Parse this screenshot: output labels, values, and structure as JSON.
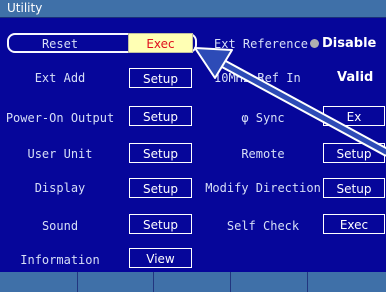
{
  "title": "Utility",
  "left_items": [
    {
      "label": "Reset",
      "button": "Exec"
    },
    {
      "label": "Ext Add",
      "button": "Setup"
    },
    {
      "label": "Power-On Output",
      "button": "Setup"
    },
    {
      "label": "User Unit",
      "button": "Setup"
    },
    {
      "label": "Display",
      "button": "Setup"
    },
    {
      "label": "Sound",
      "button": "Setup"
    },
    {
      "label": "Information",
      "button": "View"
    }
  ],
  "right_items": [
    {
      "label": "Ext Reference",
      "status": "Disable"
    },
    {
      "label": "10MHz Ref In",
      "status": "Valid"
    },
    {
      "label": "φ Sync",
      "button": "Ex"
    },
    {
      "label": "Remote",
      "button": "Setup"
    },
    {
      "label": "Modify Direction",
      "button": "Setup"
    },
    {
      "label": "Self Check",
      "button": "Exec"
    }
  ],
  "colors": {
    "background": "#06069a",
    "titlebar": "#3f70a8",
    "highlight": "#ffffb4",
    "highlight_text": "#e0101c",
    "arrow": "#2d4bb7"
  }
}
